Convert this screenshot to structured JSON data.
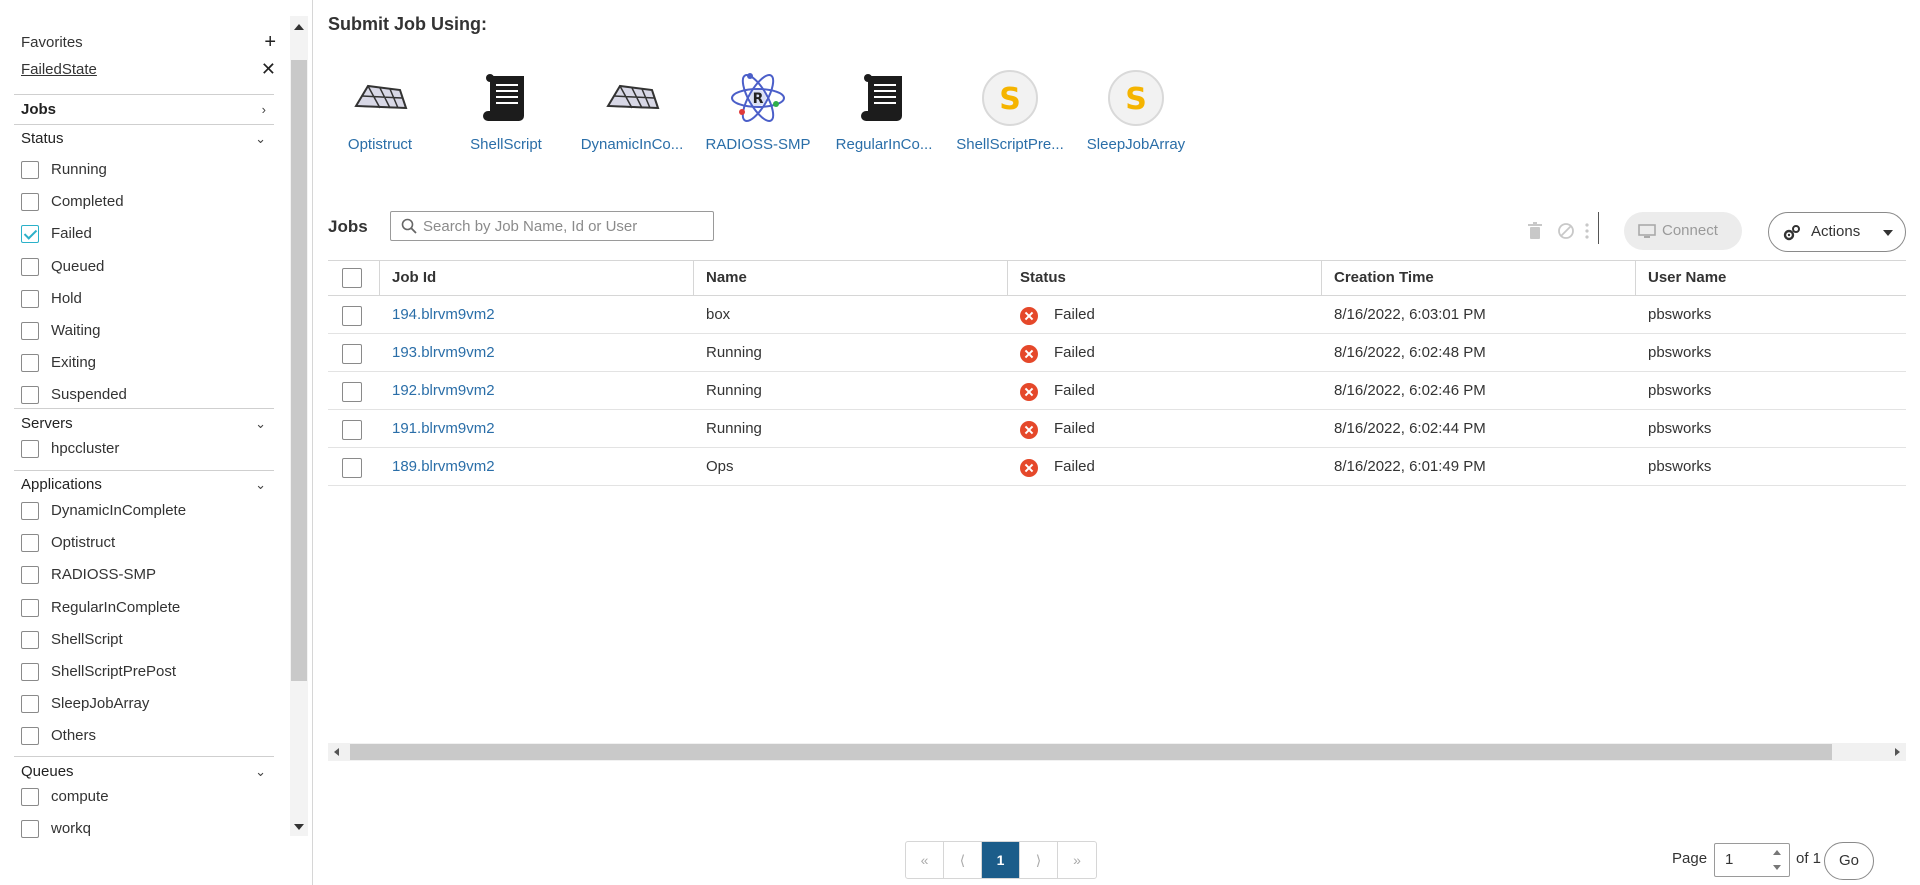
{
  "sidebar": {
    "favorites_label": "Favorites",
    "favorite_item": "FailedState",
    "jobs_label": "Jobs",
    "status_label": "Status",
    "status_items": [
      {
        "label": "Running",
        "checked": false
      },
      {
        "label": "Completed",
        "checked": false
      },
      {
        "label": "Failed",
        "checked": true
      },
      {
        "label": "Queued",
        "checked": false
      },
      {
        "label": "Hold",
        "checked": false
      },
      {
        "label": "Waiting",
        "checked": false
      },
      {
        "label": "Exiting",
        "checked": false
      },
      {
        "label": "Suspended",
        "checked": false
      }
    ],
    "servers_label": "Servers",
    "servers_items": [
      {
        "label": "hpccluster",
        "checked": false
      }
    ],
    "applications_label": "Applications",
    "applications_items": [
      {
        "label": "DynamicInComplete",
        "checked": false
      },
      {
        "label": "Optistruct",
        "checked": false
      },
      {
        "label": "RADIOSS-SMP",
        "checked": false
      },
      {
        "label": "RegularInComplete",
        "checked": false
      },
      {
        "label": "ShellScript",
        "checked": false
      },
      {
        "label": "ShellScriptPrePost",
        "checked": false
      },
      {
        "label": "SleepJobArray",
        "checked": false
      },
      {
        "label": "Others",
        "checked": false
      }
    ],
    "queues_label": "Queues",
    "queues_items": [
      {
        "label": "compute",
        "checked": false
      },
      {
        "label": "workq",
        "checked": false
      }
    ]
  },
  "submit": {
    "title": "Submit Job Using:",
    "apps": [
      {
        "name": "Optistruct",
        "icon": "mesh-icon"
      },
      {
        "name": "ShellScript",
        "icon": "scroll-icon"
      },
      {
        "name": "DynamicInCo...",
        "icon": "mesh-icon"
      },
      {
        "name": "RADIOSS-SMP",
        "icon": "atom-icon"
      },
      {
        "name": "RegularInCo...",
        "icon": "scroll-icon"
      },
      {
        "name": "ShellScriptPre...",
        "icon": "s-badge-icon"
      },
      {
        "name": "SleepJobArray",
        "icon": "s-badge-icon"
      }
    ],
    "badge_letter": "S",
    "atom_letter": "R"
  },
  "jobs": {
    "title": "Jobs",
    "search_placeholder": "Search by Job Name, Id or User",
    "connect_label": "Connect",
    "actions_label": "Actions",
    "columns": [
      "Job Id",
      "Name",
      "Status",
      "Creation Time",
      "User Name"
    ],
    "rows": [
      {
        "id": "194.blrvm9vm2",
        "name": "box",
        "status": "Failed",
        "time": "8/16/2022, 6:03:01 PM",
        "user": "pbsworks"
      },
      {
        "id": "193.blrvm9vm2",
        "name": "Running",
        "status": "Failed",
        "time": "8/16/2022, 6:02:48 PM",
        "user": "pbsworks"
      },
      {
        "id": "192.blrvm9vm2",
        "name": "Running",
        "status": "Failed",
        "time": "8/16/2022, 6:02:46 PM",
        "user": "pbsworks"
      },
      {
        "id": "191.blrvm9vm2",
        "name": "Running",
        "status": "Failed",
        "time": "8/16/2022, 6:02:44 PM",
        "user": "pbsworks"
      },
      {
        "id": "189.blrvm9vm2",
        "name": "Ops",
        "status": "Failed",
        "time": "8/16/2022, 6:01:49 PM",
        "user": "pbsworks"
      }
    ]
  },
  "pagination": {
    "first": "«",
    "prev": "⟨",
    "current": "1",
    "next": "⟩",
    "last": "»",
    "page_label": "Page",
    "page_value": "1",
    "of_label": "of 1",
    "go_label": "Go"
  },
  "colors": {
    "accent": "#2bb1c9",
    "link": "#2a6ea8",
    "failed": "#e5482a",
    "active_page": "#1c5d8a",
    "badge_yellow": "#f5b400"
  }
}
